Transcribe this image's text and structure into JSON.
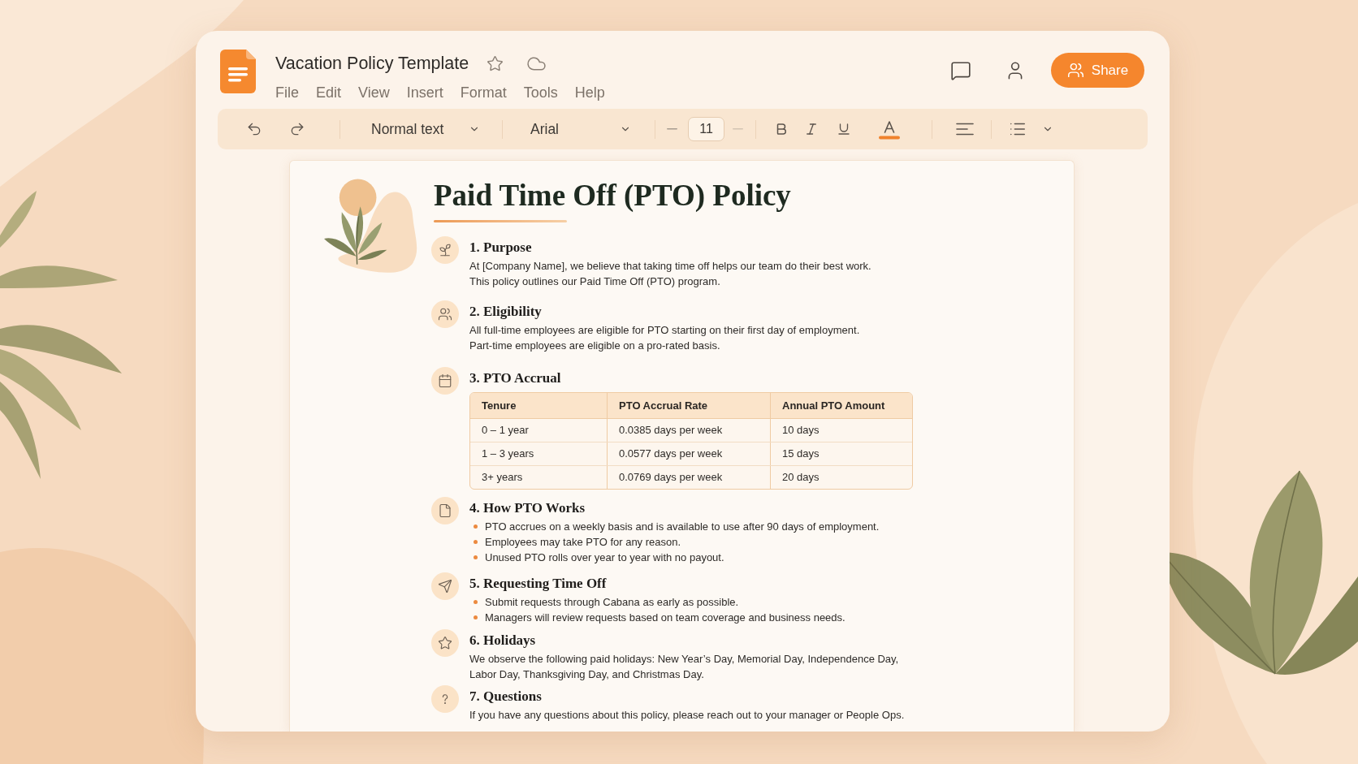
{
  "app": {
    "document_name": "Vacation Policy Template",
    "menu": [
      "File",
      "Edit",
      "View",
      "Insert",
      "Format",
      "Tools",
      "Help"
    ],
    "share_label": "Share"
  },
  "toolbar": {
    "paragraph_style": "Normal text",
    "font": "Arial",
    "font_size": "11"
  },
  "document": {
    "title": "Paid Time Off (PTO) Policy",
    "sections": [
      {
        "kind": "paragraph",
        "heading": "1. Purpose",
        "lines": [
          "At [Company Name], we believe that taking time off helps our team do their best work.",
          "This policy outlines our Paid Time Off (PTO) program."
        ]
      },
      {
        "kind": "paragraph",
        "heading": "2. Eligibility",
        "lines": [
          "All full-time employees are eligible for PTO starting on their first day of employment.",
          "Part-time employees are eligible on a pro-rated basis."
        ]
      },
      {
        "kind": "table",
        "heading": "3. PTO Accrual",
        "table": {
          "columns": [
            "Tenure",
            "PTO Accrual Rate",
            "Annual PTO Amount"
          ],
          "rows": [
            [
              "0 – 1 year",
              "0.0385 days per week",
              "10 days"
            ],
            [
              "1 – 3 years",
              "0.0577 days per week",
              "15 days"
            ],
            [
              "3+ years",
              "0.0769 days per week",
              "20 days"
            ]
          ]
        }
      },
      {
        "kind": "bullets",
        "heading": "4. How PTO Works",
        "items": [
          "PTO accrues on a weekly basis and is available to use after 90 days of employment.",
          "Employees may take PTO for any reason.",
          "Unused PTO rolls over year to year with no payout."
        ]
      },
      {
        "kind": "bullets",
        "heading": "5. Requesting Time Off",
        "items": [
          "Submit requests through Cabana as early as possible.",
          "Managers will review requests based on team coverage and business needs."
        ]
      },
      {
        "kind": "paragraph",
        "heading": "6. Holidays",
        "lines": [
          "We observe the following paid holidays: New Year’s Day, Memorial Day, Independence Day,",
          "Labor Day, Thanksgiving Day, and Christmas Day."
        ]
      },
      {
        "kind": "paragraph",
        "heading": "7. Questions",
        "lines": [
          "If you have any questions about this policy, please reach out to your manager or People Ops."
        ]
      }
    ]
  }
}
